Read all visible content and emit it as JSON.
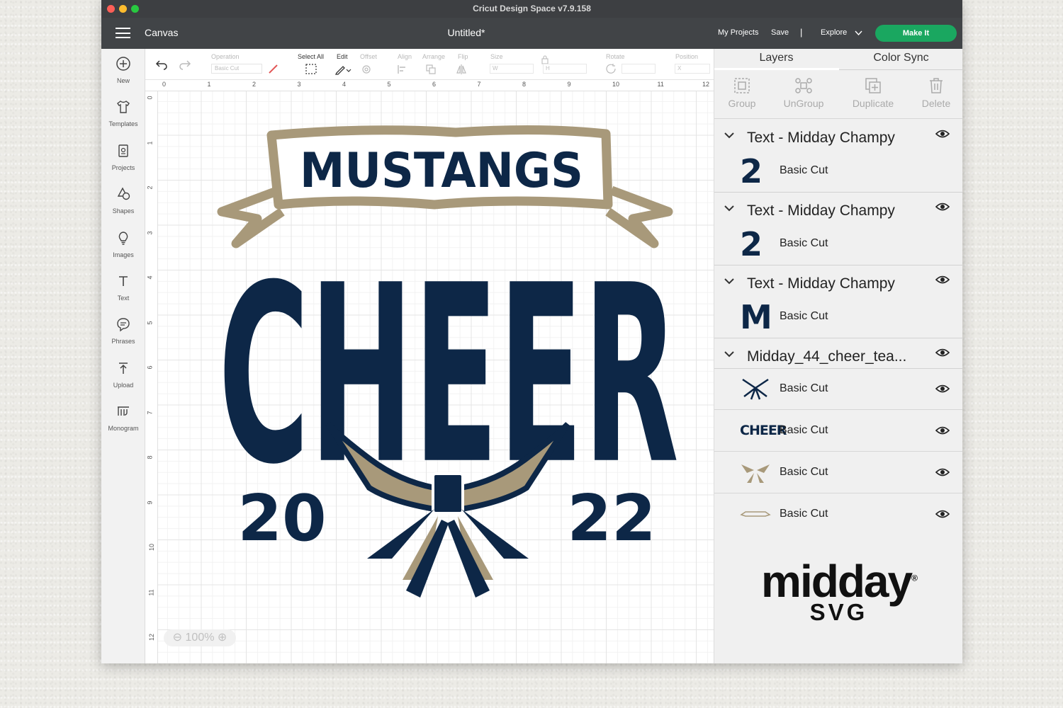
{
  "window": {
    "title": "Cricut Design Space  v7.9.158"
  },
  "appbar": {
    "section": "Canvas",
    "document_title": "Untitled*",
    "my_projects": "My Projects",
    "save": "Save",
    "separator": "|",
    "explore": "Explore",
    "make_it": "Make It"
  },
  "sidebar": {
    "items": [
      {
        "label": "New",
        "icon": "plus-circle-icon"
      },
      {
        "label": "Templates",
        "icon": "shirt-icon"
      },
      {
        "label": "Projects",
        "icon": "projects-icon"
      },
      {
        "label": "Shapes",
        "icon": "shapes-icon"
      },
      {
        "label": "Images",
        "icon": "lightbulb-icon"
      },
      {
        "label": "Text",
        "icon": "text-icon"
      },
      {
        "label": "Phrases",
        "icon": "speech-bubble-icon"
      },
      {
        "label": "Upload",
        "icon": "upload-icon"
      },
      {
        "label": "Monogram",
        "icon": "monogram-icon"
      }
    ]
  },
  "toolbar": {
    "operation_label": "Operation",
    "operation_value": "Basic Cut",
    "select_all": "Select All",
    "edit": "Edit",
    "offset": "Offset",
    "align": "Align",
    "arrange": "Arrange",
    "flip": "Flip",
    "size": "Size",
    "size_w": "W",
    "size_h": "H",
    "rotate": "Rotate",
    "position": "Position",
    "position_x": "X"
  },
  "rulers": {
    "top": [
      "0",
      "1",
      "2",
      "3",
      "4",
      "5",
      "6",
      "7",
      "8",
      "9",
      "10",
      "11",
      "12"
    ],
    "left": [
      "0",
      "1",
      "2",
      "3",
      "4",
      "5",
      "6",
      "7",
      "8",
      "9",
      "10",
      "11",
      "12"
    ]
  },
  "canvas": {
    "zoom": "100%",
    "design": {
      "banner_text": "MUSTANGS",
      "main_text": "CHEER",
      "year_left": "20",
      "year_right": "22",
      "colors": {
        "navy": "#0d2747",
        "gold": "#a8997a"
      }
    }
  },
  "panel": {
    "tabs": [
      "Layers",
      "Color Sync"
    ],
    "actions": [
      {
        "label": "Group",
        "icon": "group-icon"
      },
      {
        "label": "UnGroup",
        "icon": "ungroup-icon"
      },
      {
        "label": "Duplicate",
        "icon": "duplicate-icon"
      },
      {
        "label": "Delete",
        "icon": "trash-icon"
      }
    ],
    "layer_groups": [
      {
        "title": "Text - Midday Champy",
        "thumb": "2",
        "operation": "Basic Cut"
      },
      {
        "title": "Text - Midday Champy",
        "thumb": "2",
        "operation": "Basic Cut"
      },
      {
        "title": "Text - Midday Champy",
        "thumb": "M",
        "operation": "Basic Cut"
      }
    ],
    "design_group": {
      "title": "Midday_44_cheer_tea...",
      "layers": [
        {
          "operation": "Basic Cut",
          "thumb": "bow-navy"
        },
        {
          "operation": "Basic Cut",
          "thumb": "CHEER"
        },
        {
          "operation": "Basic Cut",
          "thumb": "bow-gold"
        },
        {
          "operation": "Basic Cut",
          "thumb": "banner"
        }
      ]
    },
    "watermark": {
      "word": "midday",
      "reg": "®",
      "sub": "SVG"
    }
  }
}
